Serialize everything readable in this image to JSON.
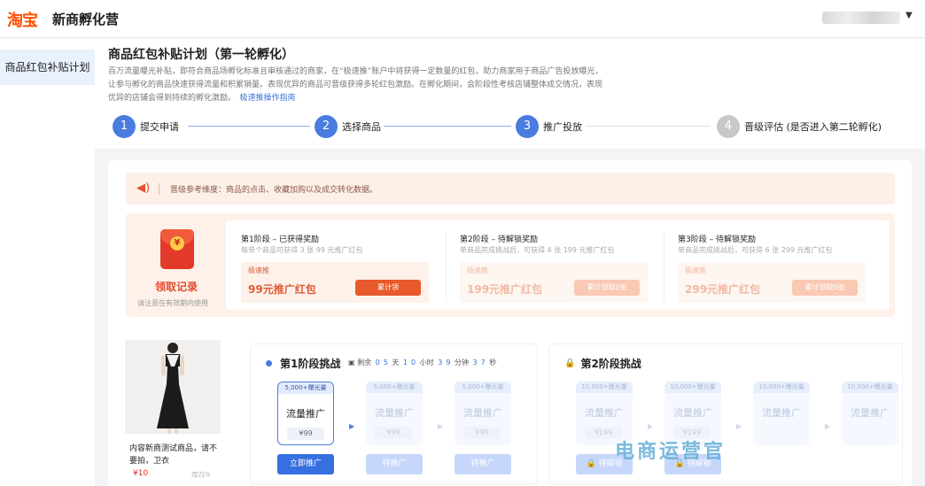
{
  "header": {
    "logo": "淘宝",
    "brand": "新商孵化营"
  },
  "sidebar": {
    "items": [
      {
        "label": "商品红包补贴计划"
      }
    ]
  },
  "page": {
    "title": "商品红包补贴计划（第一轮孵化）",
    "desc_1": "百万流量曝光补贴，即符合商品场孵化标准且审核通过的商家，在“极速推”账户中将获得一定数量的红包，助力商家用于商品广告投放曝光，",
    "desc_2": "让参与孵化的商品快速获得流量和积累销量。表现优异的商品可晋级获得多轮红包激励。在孵化期间，会阶段性考核店铺整体成交情况，表现",
    "desc_3": "优异的店铺会得到持续的孵化激励。",
    "guide_link": "极速推操作指南"
  },
  "steps": [
    {
      "num": "1",
      "label": "提交申请",
      "state": "done"
    },
    {
      "num": "2",
      "label": "选择商品",
      "state": "done"
    },
    {
      "num": "3",
      "label": "推广投放",
      "state": "current"
    },
    {
      "num": "4",
      "label": "晋级评估 (是否进入第二轮孵化)",
      "state": "todo"
    }
  ],
  "notice": {
    "text": "晋级参考维度：商品的点击、收藏加购以及成交转化数据。"
  },
  "reward": {
    "icon": "red-envelope-icon",
    "coin_symbol": "¥",
    "record_label": "领取记录",
    "hint": "请注意在有效期内使用",
    "stages": [
      {
        "title": "第1阶段 – 已获得奖励",
        "sub": "每单个商品可获得 3 张 99 元推广红包",
        "tag": "极速推",
        "amount": "99元推广红包",
        "button": "累计领"
      },
      {
        "title": "第2阶段 – 待解锁奖励",
        "sub": "单商品完成挑战后，可获得 4 张 199 元推广红包",
        "tag": "极速推",
        "amount": "199元推广红包",
        "button": "累计领取0张"
      },
      {
        "title": "第3阶段 – 待解锁奖励",
        "sub": "单商品完成挑战后，可获得 6 张 299 元推广红包",
        "tag": "极速推",
        "amount": "299元推广红包",
        "button": "累计领取0张"
      }
    ]
  },
  "product": {
    "name": "内容新商测试商品，请不要拍，卫衣",
    "price": "¥10",
    "stock": "库存9"
  },
  "stage1": {
    "title": "第1阶段挑战",
    "timer": {
      "prefix": "剩余",
      "d1": "0",
      "d2": "5",
      "day": "天",
      "h1": "1",
      "h2": "0",
      "hour": "小时",
      "m1": "3",
      "m2": "9",
      "minute": "分钟",
      "s1": "3",
      "s2": "7",
      "second": "秒"
    },
    "options": [
      {
        "exposure": "5,000+曝光量",
        "name": "流量推广",
        "price": "¥99",
        "button": "立即推广"
      },
      {
        "exposure": "5,000+曝光量",
        "name": "流量推广",
        "price": "¥99",
        "button": "待推广"
      },
      {
        "exposure": "5,000+曝光量",
        "name": "流量推广",
        "price": "¥99",
        "button": "待推广"
      }
    ]
  },
  "stage2": {
    "title": "第2阶段挑战",
    "options": [
      {
        "exposure": "10,000+曝光量",
        "name": "流量推广",
        "price": "¥199",
        "button": "待解锁"
      },
      {
        "exposure": "10,000+曝光量",
        "name": "流量推广",
        "price": "¥199",
        "button": "待解锁"
      },
      {
        "exposure": "10,000+曝光量",
        "name": "流量推广",
        "price": ""
      },
      {
        "exposure": "10,000+曝光量",
        "name": "流量推广",
        "price": ""
      }
    ]
  },
  "watermark": "电商运营官",
  "colors": {
    "brand": "#ff5000",
    "primary": "#3670e0",
    "accent_red": "#e85a2b"
  }
}
